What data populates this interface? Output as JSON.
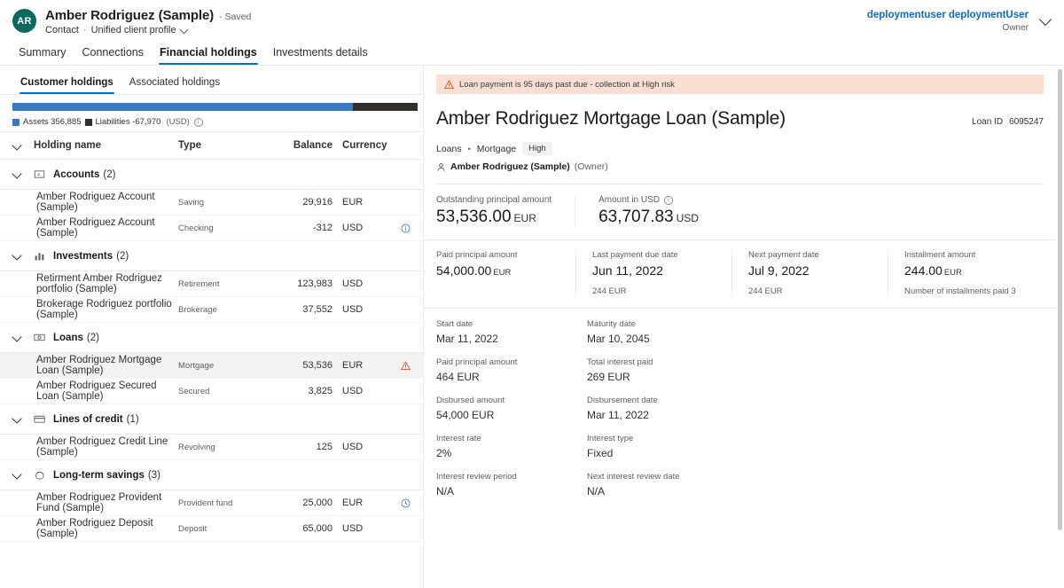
{
  "header": {
    "avatar_initials": "AR",
    "title": "Amber Rodriguez (Sample)",
    "saved_status": "- Saved",
    "entity_type": "Contact",
    "separator_dot": "·",
    "profile_label": "Unified client profile",
    "user_name": "deploymentuser deploymentUser",
    "user_role": "Owner"
  },
  "main_tabs": [
    {
      "label": "Summary",
      "active": false
    },
    {
      "label": "Connections",
      "active": false
    },
    {
      "label": "Financial holdings",
      "active": true
    },
    {
      "label": "Investments details",
      "active": false
    }
  ],
  "left_panel": {
    "sub_tabs": [
      {
        "label": "Customer holdings",
        "active": true
      },
      {
        "label": "Associated holdings",
        "active": false
      }
    ],
    "chart_data": {
      "type": "bar",
      "orientation": "horizontal-stacked",
      "title": "",
      "currency": "(USD)",
      "categories": [
        "Assets",
        "Liabilities"
      ],
      "values": [
        356885,
        -67970
      ],
      "labels": [
        "Assets 356,885",
        "Liabilities -67,970"
      ],
      "colors": [
        "#3a79bf",
        "#332f2c"
      ],
      "segment_percents": [
        84,
        16
      ],
      "legend": "inline-below"
    },
    "columns": {
      "name": "Holding name",
      "type": "Type",
      "balance": "Balance",
      "currency": "Currency"
    },
    "groups": [
      {
        "label": "Accounts",
        "count": "(2)",
        "icon": "account-icon",
        "items": [
          {
            "name": "Amber Rodriguez Account (Sample)",
            "type": "Saving",
            "balance": "29,916",
            "currency": "EUR",
            "flag": "",
            "selected": false
          },
          {
            "name": "Amber Rodriguez Account (Sample)",
            "type": "Checking",
            "balance": "-312",
            "currency": "USD",
            "flag": "info",
            "selected": false
          }
        ]
      },
      {
        "label": "Investments",
        "count": "(2)",
        "icon": "chart-icon",
        "items": [
          {
            "name": "Retirment Amber Rodriguez portfolio (Sample)",
            "type": "Retirement",
            "balance": "123,983",
            "currency": "USD",
            "flag": "",
            "selected": false
          },
          {
            "name": "Brokerage Rodriguez portfolio (Sample)",
            "type": "Brokerage",
            "balance": "37,552",
            "currency": "USD",
            "flag": "",
            "selected": false
          }
        ]
      },
      {
        "label": "Loans",
        "count": "(2)",
        "icon": "money-icon",
        "items": [
          {
            "name": "Amber Rodriguez Mortgage Loan (Sample)",
            "type": "Mortgage",
            "balance": "53,536",
            "currency": "EUR",
            "flag": "warning",
            "selected": true
          },
          {
            "name": "Amber Rodriguez Secured Loan (Sample)",
            "type": "Secured",
            "balance": "3,825",
            "currency": "USD",
            "flag": "",
            "selected": false
          }
        ]
      },
      {
        "label": "Lines of credit",
        "count": "(1)",
        "icon": "card-icon",
        "items": [
          {
            "name": "Amber Rodriguez Credit Line (Sample)",
            "type": "Revolving",
            "balance": "125",
            "currency": "USD",
            "flag": "",
            "selected": false
          }
        ]
      },
      {
        "label": "Long-term savings",
        "count": "(3)",
        "icon": "piggy-icon",
        "items": [
          {
            "name": "Amber Rodriguez Provident Fund (Sample)",
            "type": "Provident fund",
            "balance": "25,000",
            "currency": "EUR",
            "flag": "clock",
            "selected": false
          },
          {
            "name": "Amber Rodriguez Deposit (Sample)",
            "type": "Deposit",
            "balance": "65,000",
            "currency": "USD",
            "flag": "",
            "selected": false
          }
        ]
      }
    ]
  },
  "right_panel": {
    "alert": "Loan payment is 95 days past due - collection at High risk",
    "loan_title": "Amber Rodriguez Mortgage Loan (Sample)",
    "loan_id_label": "Loan ID",
    "loan_id_value": "6095247",
    "breadcrumb_1": "Loans",
    "breadcrumb_dot": "•",
    "breadcrumb_2": "Mortgage",
    "risk_badge": "High",
    "owner_name": "Amber Rodriguez (Sample)",
    "owner_tag": "(Owner)",
    "primary_amounts": [
      {
        "label": "Outstanding principal amount",
        "value": "53,536.00",
        "currency": "EUR",
        "has_info": false
      },
      {
        "label": "Amount in USD",
        "value": "63,707.83",
        "currency": "USD",
        "has_info": true
      }
    ],
    "quad": [
      {
        "label": "Paid principal amount",
        "value": "54,000.00",
        "currency": "EUR",
        "sub": ""
      },
      {
        "label": "Last payment due date",
        "value": "Jun 11, 2022",
        "currency": "",
        "sub": "244 EUR"
      },
      {
        "label": "Next payment date",
        "value": "Jul 9, 2022",
        "currency": "",
        "sub": "244 EUR"
      },
      {
        "label": "Installment amount",
        "value": "244.00",
        "currency": "EUR",
        "sub": "Number of installments paid 3"
      }
    ],
    "fields": [
      [
        {
          "label": "Start date",
          "value": "Mar 11, 2022"
        },
        {
          "label": "Maturity date",
          "value": "Mar 10, 2045"
        }
      ],
      [
        {
          "label": "Paid principal amount",
          "value": "464 EUR"
        },
        {
          "label": "Total interest paid",
          "value": "269 EUR"
        }
      ],
      [
        {
          "label": "Disbursed amount",
          "value": "54,000 EUR"
        },
        {
          "label": "Disbursement date",
          "value": "Mar 11, 2022"
        }
      ],
      [
        {
          "label": "Interest rate",
          "value": "2%"
        },
        {
          "label": "Interest type",
          "value": "Fixed"
        }
      ],
      [
        {
          "label": "Interest review period",
          "value": "N/A"
        },
        {
          "label": "Next interest review date",
          "value": "N/A"
        }
      ]
    ]
  },
  "colors": {
    "accent": "#0f6cbd",
    "assets": "#3a79bf",
    "liabilities": "#332f2c",
    "alert_bg": "#fbdfd3",
    "warning": "#d83b01",
    "avatar_bg": "#0b6a5f"
  }
}
